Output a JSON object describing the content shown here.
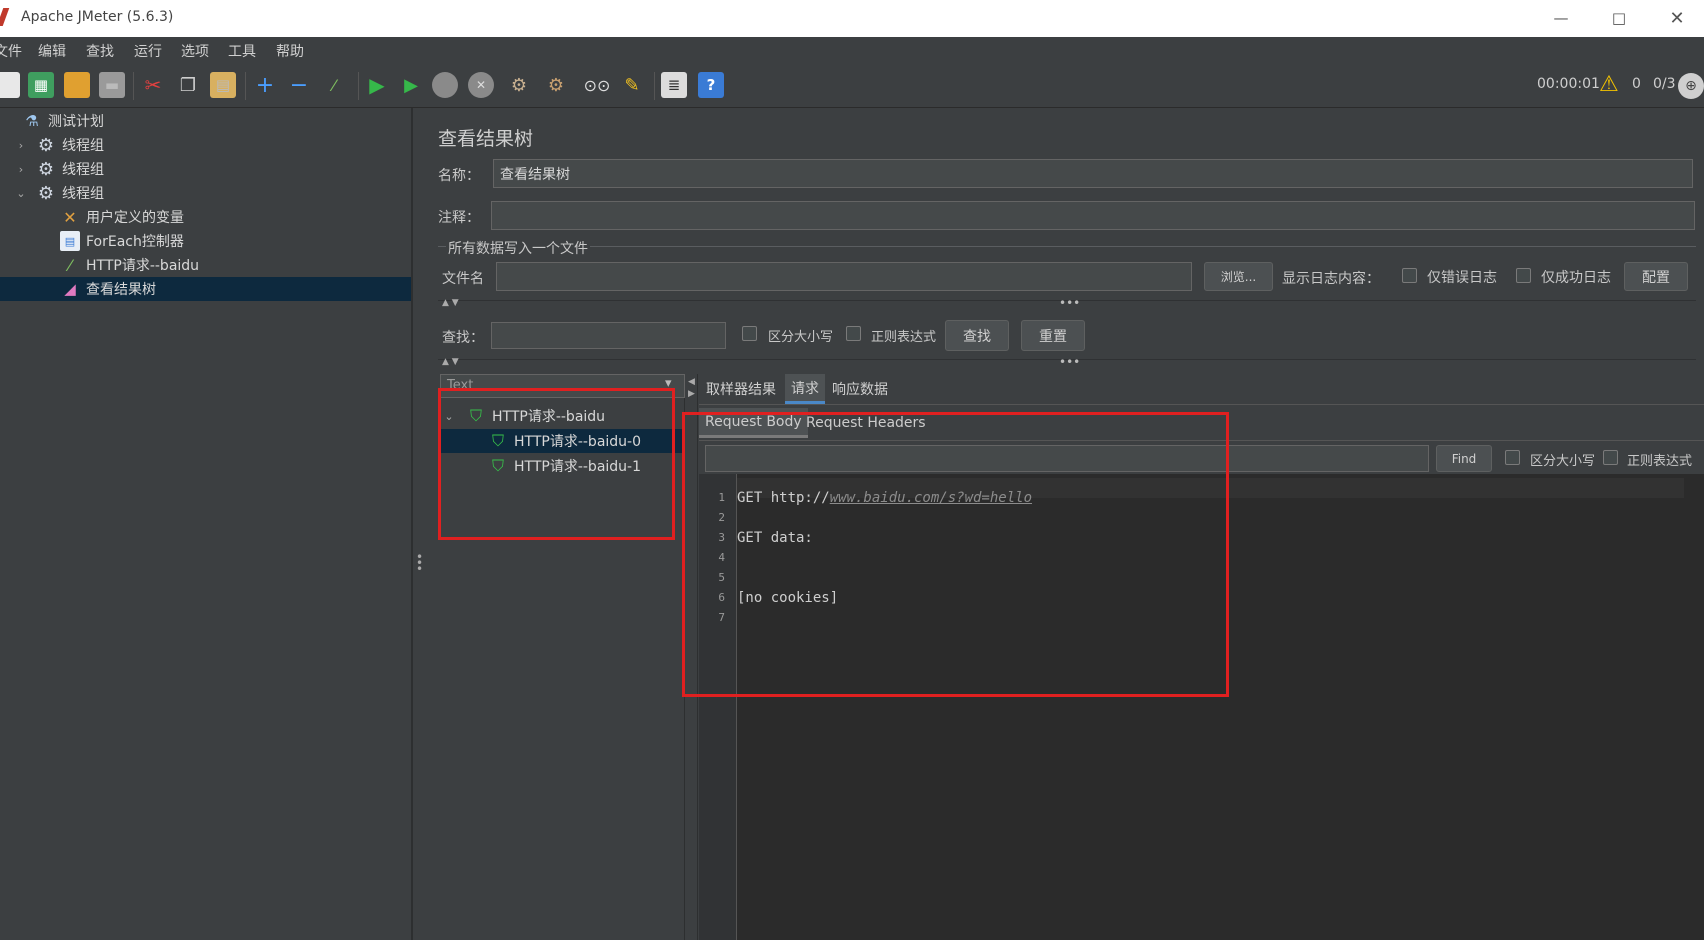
{
  "window": {
    "title": "Apache JMeter (5.6.3)"
  },
  "menu": [
    "文件",
    "编辑",
    "查找",
    "运行",
    "选项",
    "工具",
    "帮助"
  ],
  "status": {
    "time": "00:00:01",
    "warnings": "0",
    "threads": "0/3"
  },
  "tree": [
    {
      "label": "测试计划",
      "level": 0,
      "expand": "",
      "icon": "flask-icon"
    },
    {
      "label": "线程组",
      "level": 1,
      "expand": "›",
      "icon": "gear-icon"
    },
    {
      "label": "线程组",
      "level": 1,
      "expand": "›",
      "icon": "gear-icon"
    },
    {
      "label": "线程组",
      "level": 1,
      "expand": "⌄",
      "icon": "gear-icon"
    },
    {
      "label": "用户定义的变量",
      "level": 2,
      "expand": "",
      "icon": "wrench-icon"
    },
    {
      "label": "ForEach控制器",
      "level": 2,
      "expand": "",
      "icon": "controller-icon"
    },
    {
      "label": "HTTP请求--baidu",
      "level": 2,
      "expand": "",
      "icon": "pipette-icon"
    },
    {
      "label": "查看结果树",
      "level": 2,
      "expand": "",
      "icon": "listener-icon",
      "selected": true
    }
  ],
  "panel": {
    "title": "查看结果树",
    "name_label": "名称：",
    "name_value": "查看结果树",
    "comment_label": "注释：",
    "comment_value": "",
    "file_section": "所有数据写入一个文件",
    "filename_label": "文件名",
    "browse": "浏览...",
    "log_label": "显示日志内容：",
    "errors_only": "仅错误日志",
    "success_only": "仅成功日志",
    "configure": "配置",
    "search_label": "查找：",
    "case_sensitive": "区分大小写",
    "regex": "正则表达式",
    "find_btn": "查找",
    "reset_btn": "重置"
  },
  "renderer": "Text",
  "results": [
    {
      "label": "HTTP请求--baidu",
      "level": 0
    },
    {
      "label": "HTTP请求--baidu-0",
      "level": 1,
      "selected": true
    },
    {
      "label": "HTTP请求--baidu-1",
      "level": 1
    }
  ],
  "tabs": [
    "取样器结果",
    "请求",
    "响应数据"
  ],
  "subtabs": [
    "Request Body",
    "Request Headers"
  ],
  "editor_search": {
    "find": "Find",
    "case_sensitive": "区分大小写",
    "regex": "正则表达式"
  },
  "code": {
    "line1_prefix": "GET http://",
    "line1_url": "www.baidu.com/s?wd=hello",
    "line3": "GET data:",
    "line6": "[no cookies]",
    "line_numbers": [
      "1",
      "2",
      "3",
      "4",
      "5",
      "6",
      "7"
    ]
  }
}
